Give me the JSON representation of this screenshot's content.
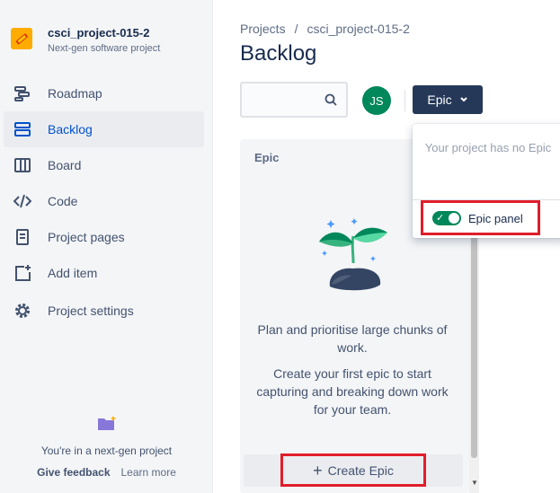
{
  "sidebar": {
    "project_name": "csci_project-015-2",
    "project_type": "Next-gen software project",
    "items": [
      {
        "label": "Roadmap",
        "icon": "roadmap-icon"
      },
      {
        "label": "Backlog",
        "icon": "backlog-icon",
        "active": true
      },
      {
        "label": "Board",
        "icon": "board-icon"
      },
      {
        "label": "Code",
        "icon": "code-icon"
      },
      {
        "label": "Project pages",
        "icon": "page-icon"
      },
      {
        "label": "Add item",
        "icon": "add-item-icon"
      },
      {
        "label": "Project settings",
        "icon": "gear-icon"
      }
    ],
    "footer_text": "You're in a next-gen project",
    "give_feedback": "Give feedback",
    "learn_more": "Learn more"
  },
  "breadcrumb": {
    "projects": "Projects",
    "separator": "/",
    "project": "csci_project-015-2"
  },
  "page_title": "Backlog",
  "search": {
    "placeholder": ""
  },
  "user_avatar": "JS",
  "epic_button": "Epic",
  "epic_panel": {
    "title": "Epic",
    "desc1": "Plan and prioritise large chunks of work.",
    "desc2": "Create your first epic to start capturing and breaking down work for your team.",
    "create_label": "Create Epic"
  },
  "dropdown": {
    "empty_text": "Your project has no Epic",
    "toggle_label": "Epic panel",
    "toggle_on": true
  },
  "colors": {
    "accent": "#0052cc",
    "button_dark": "#253858",
    "toggle_on": "#00875a",
    "highlight_box": "#e01e2a"
  }
}
